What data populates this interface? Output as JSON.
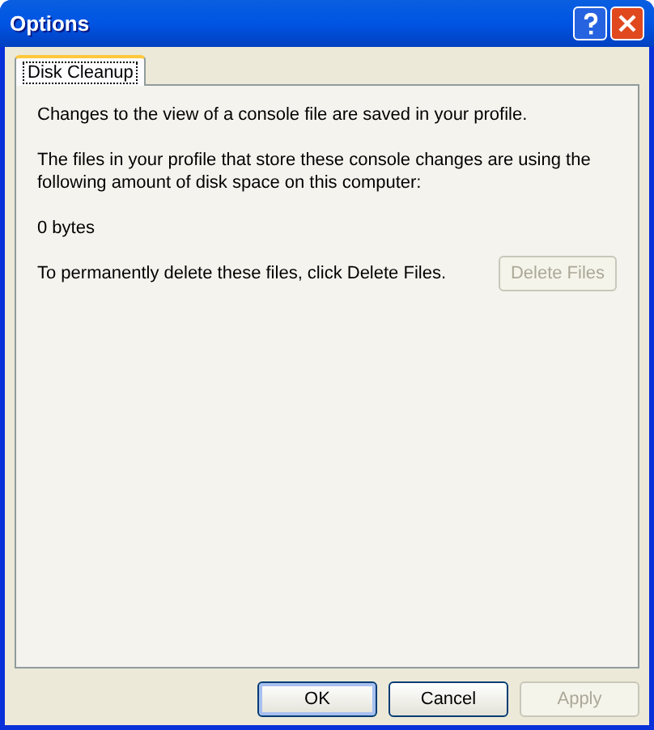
{
  "window": {
    "title": "Options"
  },
  "tabs": [
    {
      "label": "Disk Cleanup",
      "selected": true
    }
  ],
  "panel": {
    "paragraphs": [
      "Changes to the view of a console file are saved in your profile.",
      "The files in your profile that store these console changes are using the following amount of disk space on this computer:",
      "0 bytes"
    ],
    "delete_text": "To permanently delete these files, click Delete Files.",
    "delete_button": {
      "label": "Delete Files",
      "disabled": true
    }
  },
  "buttons": [
    {
      "label": "OK",
      "disabled": false,
      "default": true
    },
    {
      "label": "Cancel",
      "disabled": false,
      "default": false
    },
    {
      "label": "Apply",
      "disabled": true,
      "default": false
    }
  ]
}
